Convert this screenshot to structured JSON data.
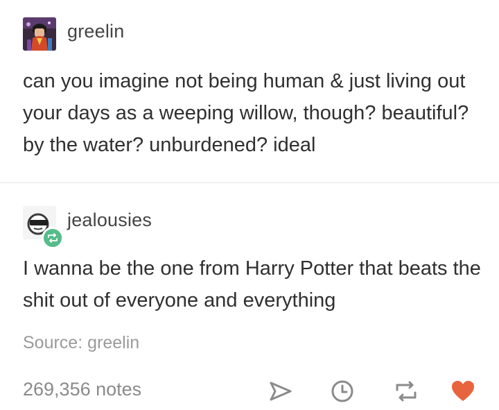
{
  "posts": [
    {
      "username": "greelin",
      "text": "can you imagine not being human & just living out your days as a weeping willow, though? beautiful? by the water? unburdened? ideal"
    },
    {
      "username": "jealousies",
      "text": "I wanna be the one from Harry Potter that beats the shit out of everyone and everything"
    }
  ],
  "source": "Source: greelin",
  "notes": "269,356 notes",
  "icons": {
    "share": "share-icon",
    "queue": "clock-icon",
    "reblog": "reblog-icon",
    "like": "heart-icon"
  },
  "colors": {
    "reblog_badge": "#56bc8a",
    "heart": "#e7643f",
    "icon": "#8a8a8a"
  }
}
